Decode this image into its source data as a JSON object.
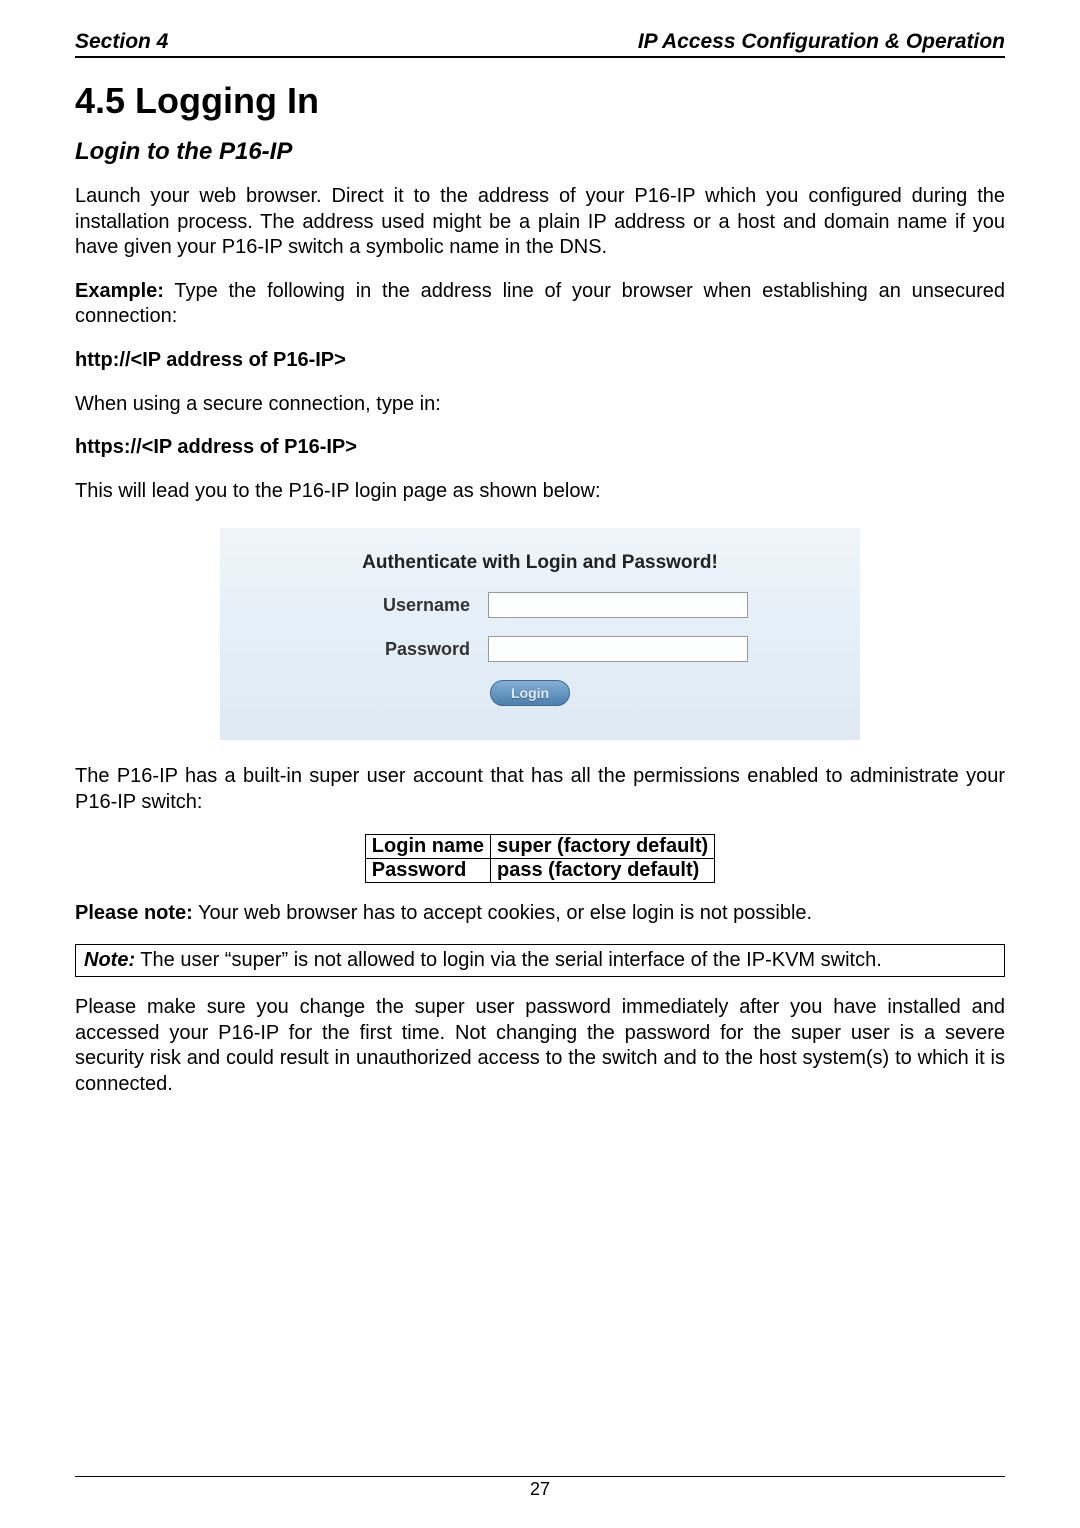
{
  "header": {
    "left": "Section 4",
    "right": "IP Access Configuration & Operation"
  },
  "section_title": "4.5  Logging In",
  "subheading": "Login to the P16-IP",
  "paragraphs": {
    "p1": "Launch your web browser. Direct it to the address of your P16-IP which you configured during the installation process. The address used might be a plain IP address or a host and domain name if you have given your P16-IP switch a symbolic name in the DNS.",
    "example_label": "Example:",
    "example_text": " Type the following in the address line of your browser when establishing an unsecured connection:",
    "http_line": "http://<IP address of P16-IP>",
    "secure_intro": "When using a secure connection, type in:",
    "https_line": "https://<IP address of P16-IP>",
    "lead_login": "This will lead you to the P16-IP login page as shown below:",
    "after_login": "The P16-IP has a built-in super user account that has all the permissions enabled to administrate your P16-IP switch:",
    "please_note_label": "Please note:",
    "please_note_text": " Your web browser has to accept cookies, or else login is not possible.",
    "note_label": "Note:",
    "note_text": " The user “super” is not allowed to login via the serial interface of the IP-KVM switch.",
    "closing": "Please make sure you change the super user password immediately after you have installed and accessed your P16-IP for the first time. Not changing the password for the super user is a severe security risk and could result in unauthorized access to the switch and to the host system(s) to which it is connected."
  },
  "login_figure": {
    "title": "Authenticate with Login and Password!",
    "username_label": "Username",
    "username_value": "",
    "password_label": "Password",
    "password_value": "",
    "button_label": "Login"
  },
  "credentials": {
    "row1_label": "Login name",
    "row1_value": "super (factory default)",
    "row2_label": "Password",
    "row2_value": "pass (factory default)"
  },
  "footer": {
    "page_number": "27"
  }
}
